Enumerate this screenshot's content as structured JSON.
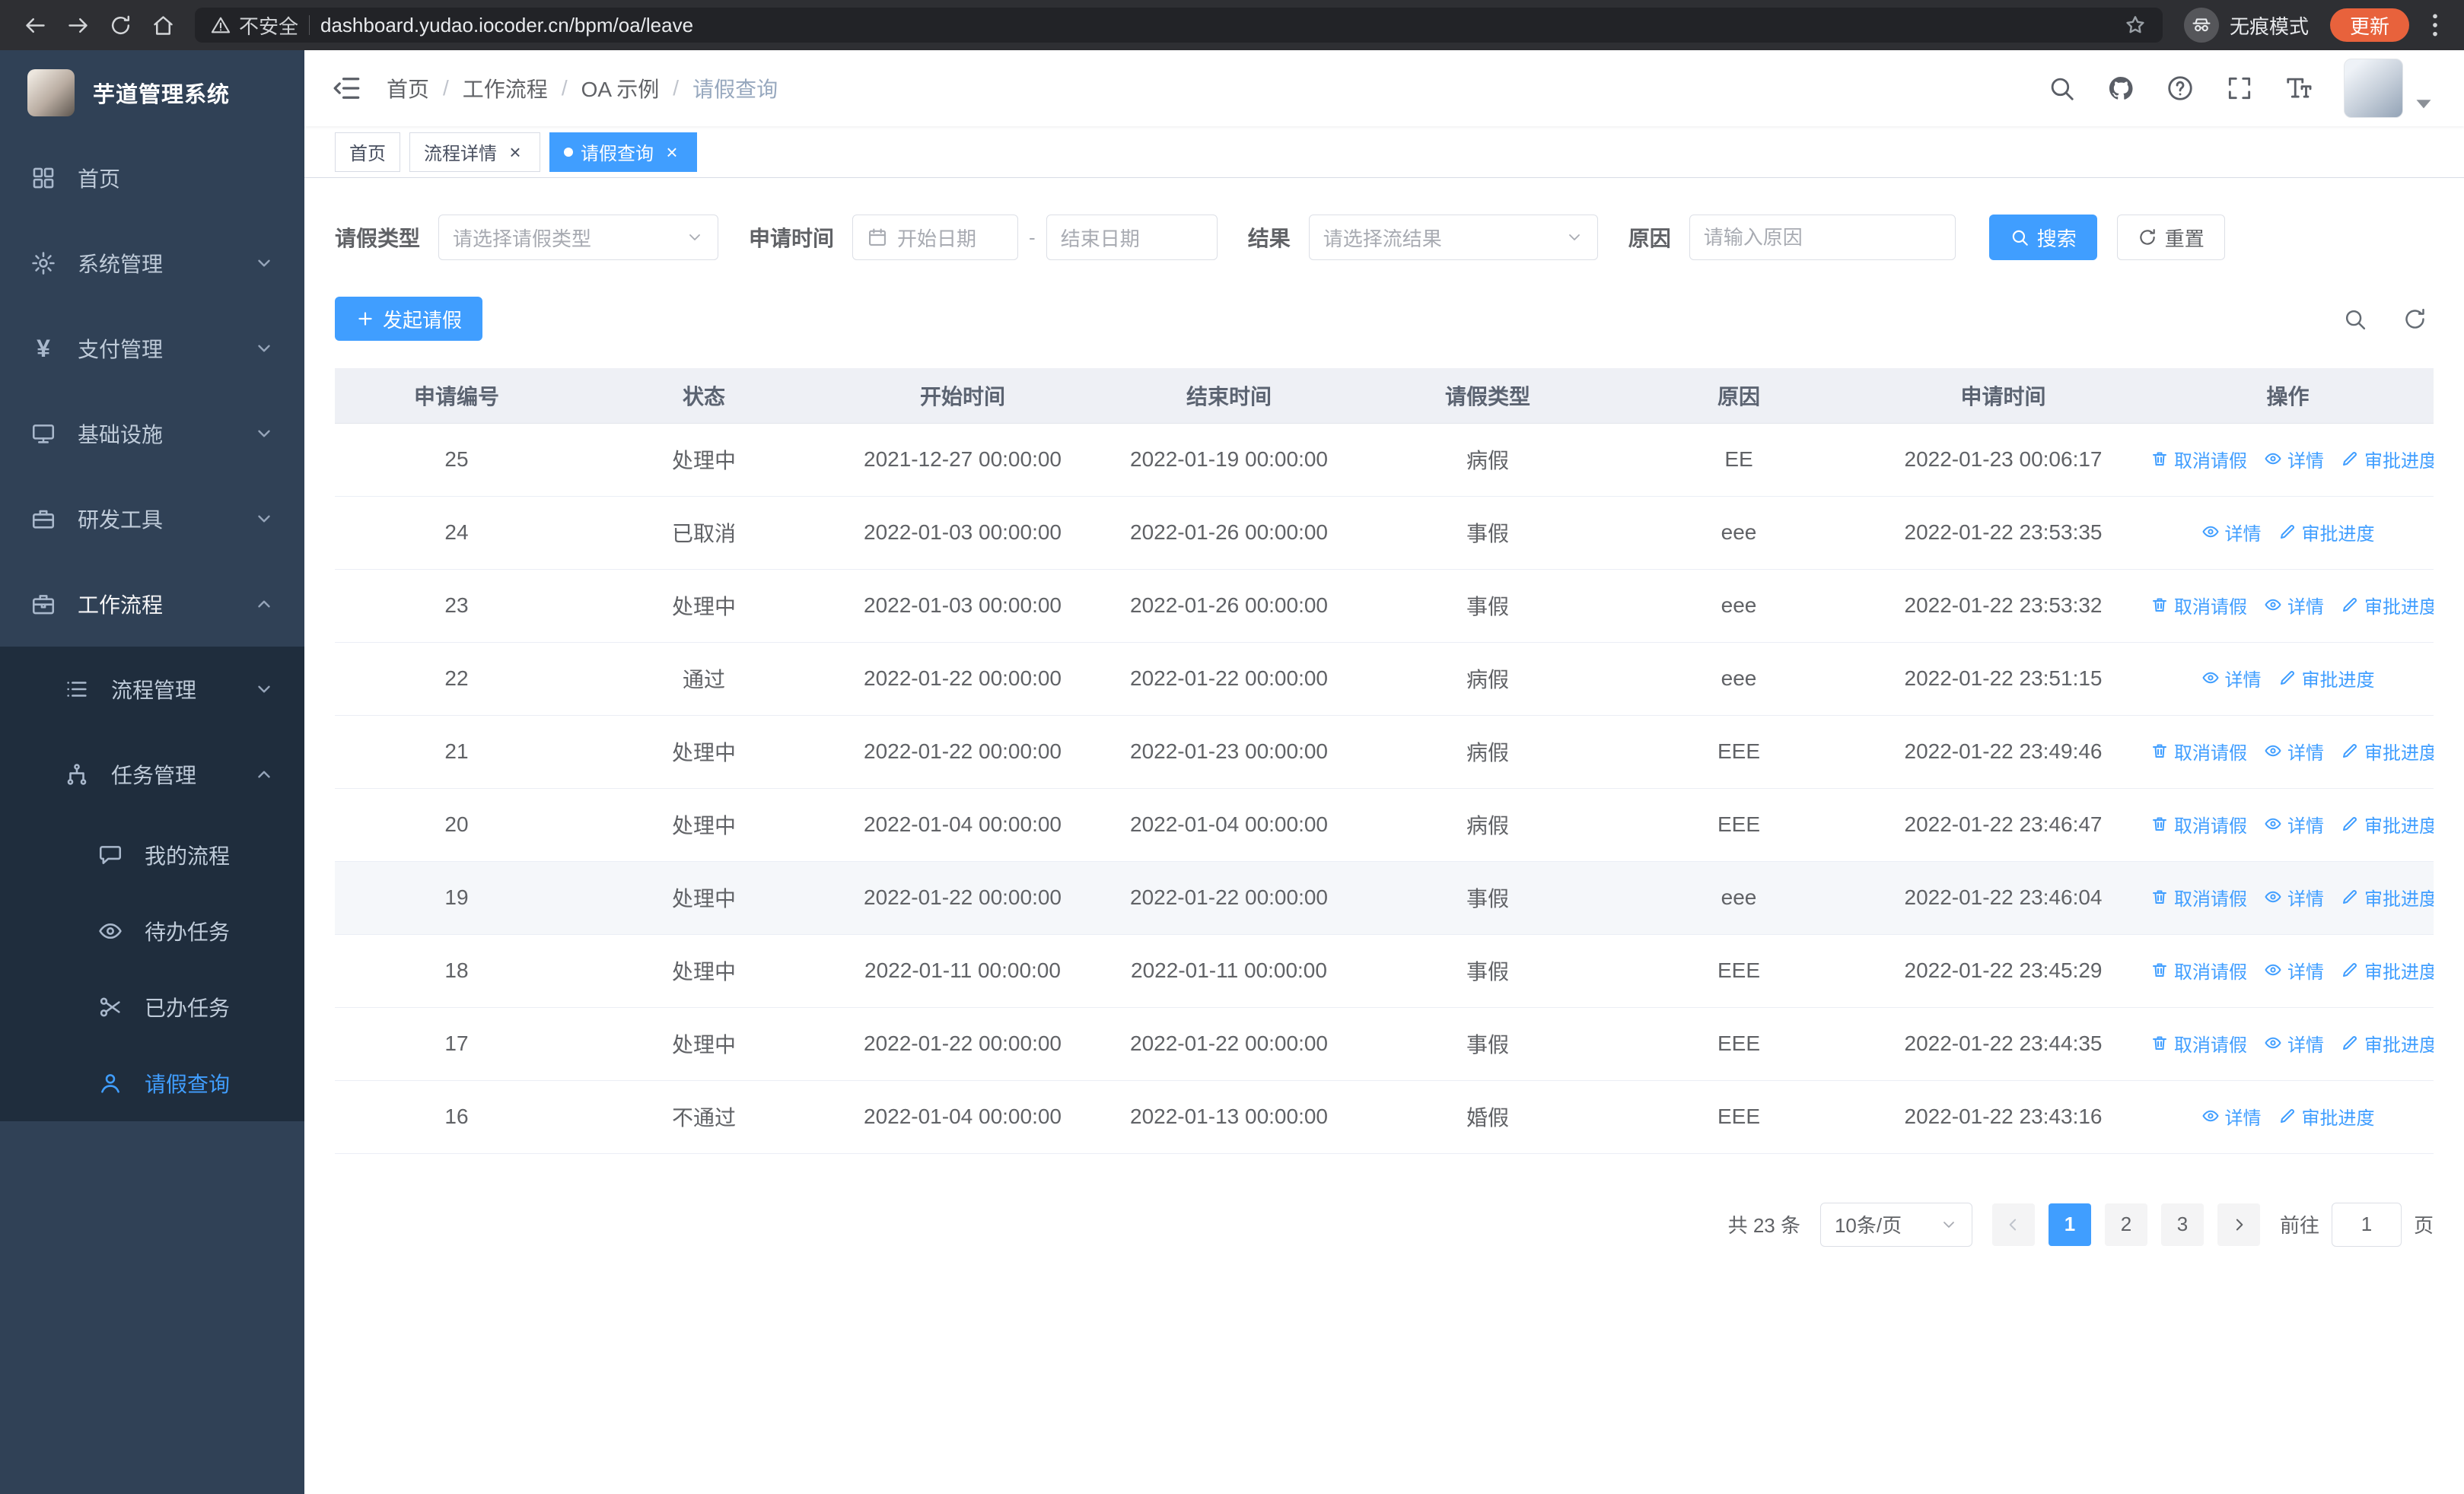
{
  "colors": {
    "accent": "#409eff",
    "sidebar": "#304156",
    "sidebar-sub": "#1f2d3d",
    "update": "#e8623c"
  },
  "browser": {
    "security_label": "不安全",
    "url": "dashboard.yudao.iocoder.cn/bpm/oa/leave",
    "incognito_label": "无痕模式",
    "update_label": "更新"
  },
  "sidebar": {
    "logo_title": "芋道管理系统",
    "menu": [
      {
        "key": "home",
        "icon": "grid",
        "label": "首页"
      },
      {
        "key": "system",
        "icon": "gear",
        "label": "系统管理",
        "expandable": true
      },
      {
        "key": "payment",
        "icon": "yen",
        "label": "支付管理",
        "expandable": true
      },
      {
        "key": "infra",
        "icon": "monitor",
        "label": "基础设施",
        "expandable": true
      },
      {
        "key": "devtools",
        "icon": "toolbox",
        "label": "研发工具",
        "expandable": true
      },
      {
        "key": "workflow",
        "icon": "briefcase",
        "label": "工作流程",
        "expandable": true,
        "expanded": true,
        "children": [
          {
            "key": "process-manage",
            "icon": "list",
            "label": "流程管理",
            "expandable": true
          },
          {
            "key": "task-manage",
            "icon": "branch",
            "label": "任务管理",
            "expandable": true,
            "expanded": true,
            "children": [
              {
                "key": "my-process",
                "icon": "chat",
                "label": "我的流程"
              },
              {
                "key": "todo-task",
                "icon": "eye",
                "label": "待办任务"
              },
              {
                "key": "done-task",
                "icon": "scissors",
                "label": "已办任务"
              },
              {
                "key": "leave-query",
                "icon": "user",
                "label": "请假查询",
                "active": true
              }
            ]
          }
        ]
      }
    ]
  },
  "header": {
    "breadcrumb": [
      "首页",
      "工作流程",
      "OA 示例",
      "请假查询"
    ]
  },
  "tabs": [
    {
      "key": "home",
      "label": "首页"
    },
    {
      "key": "process-detail",
      "label": "流程详情",
      "closable": true
    },
    {
      "key": "leave-query",
      "label": "请假查询",
      "closable": true,
      "active": true
    }
  ],
  "filters": {
    "leave_type_label": "请假类型",
    "leave_type_placeholder": "请选择请假类型",
    "apply_time_label": "申请时间",
    "start_date_placeholder": "开始日期",
    "range_separator": "-",
    "end_date_placeholder": "结束日期",
    "result_label": "结果",
    "result_placeholder": "请选择流结果",
    "reason_label": "原因",
    "reason_placeholder": "请输入原因",
    "search_label": "搜索",
    "reset_label": "重置"
  },
  "toolbar": {
    "create_label": "发起请假"
  },
  "table": {
    "columns": [
      "申请编号",
      "状态",
      "开始时间",
      "结束时间",
      "请假类型",
      "原因",
      "申请时间",
      "操作"
    ],
    "actions": {
      "cancel": "取消请假",
      "detail": "详情",
      "progress": "审批进度"
    },
    "rows": [
      {
        "id": "25",
        "status": "处理中",
        "start": "2021-12-27 00:00:00",
        "end": "2022-01-19 00:00:00",
        "type": "病假",
        "reason": "EE",
        "applied": "2022-01-23 00:06:17",
        "cancellable": true
      },
      {
        "id": "24",
        "status": "已取消",
        "start": "2022-01-03 00:00:00",
        "end": "2022-01-26 00:00:00",
        "type": "事假",
        "reason": "eee",
        "applied": "2022-01-22 23:53:35",
        "cancellable": false
      },
      {
        "id": "23",
        "status": "处理中",
        "start": "2022-01-03 00:00:00",
        "end": "2022-01-26 00:00:00",
        "type": "事假",
        "reason": "eee",
        "applied": "2022-01-22 23:53:32",
        "cancellable": true
      },
      {
        "id": "22",
        "status": "通过",
        "start": "2022-01-22 00:00:00",
        "end": "2022-01-22 00:00:00",
        "type": "病假",
        "reason": "eee",
        "applied": "2022-01-22 23:51:15",
        "cancellable": false
      },
      {
        "id": "21",
        "status": "处理中",
        "start": "2022-01-22 00:00:00",
        "end": "2022-01-23 00:00:00",
        "type": "病假",
        "reason": "EEE",
        "applied": "2022-01-22 23:49:46",
        "cancellable": true
      },
      {
        "id": "20",
        "status": "处理中",
        "start": "2022-01-04 00:00:00",
        "end": "2022-01-04 00:00:00",
        "type": "病假",
        "reason": "EEE",
        "applied": "2022-01-22 23:46:47",
        "cancellable": true
      },
      {
        "id": "19",
        "status": "处理中",
        "start": "2022-01-22 00:00:00",
        "end": "2022-01-22 00:00:00",
        "type": "事假",
        "reason": "eee",
        "applied": "2022-01-22 23:46:04",
        "cancellable": true,
        "hover": true
      },
      {
        "id": "18",
        "status": "处理中",
        "start": "2022-01-11 00:00:00",
        "end": "2022-01-11 00:00:00",
        "type": "事假",
        "reason": "EEE",
        "applied": "2022-01-22 23:45:29",
        "cancellable": true
      },
      {
        "id": "17",
        "status": "处理中",
        "start": "2022-01-22 00:00:00",
        "end": "2022-01-22 00:00:00",
        "type": "事假",
        "reason": "EEE",
        "applied": "2022-01-22 23:44:35",
        "cancellable": true
      },
      {
        "id": "16",
        "status": "不通过",
        "start": "2022-01-04 00:00:00",
        "end": "2022-01-13 00:00:00",
        "type": "婚假",
        "reason": "EEE",
        "applied": "2022-01-22 23:43:16",
        "cancellable": false
      }
    ]
  },
  "pagination": {
    "total_label": "共 23 条",
    "page_size": "10条/页",
    "pages": [
      "1",
      "2",
      "3"
    ],
    "active_page": "1",
    "goto_label": "前往",
    "goto_value": "1",
    "page_suffix": "页"
  }
}
